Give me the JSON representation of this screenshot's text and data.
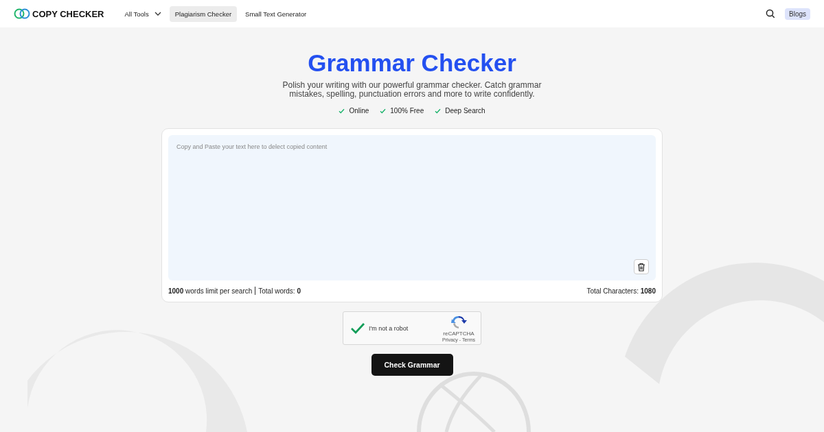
{
  "header": {
    "logo": "COPY CHECKER",
    "nav": [
      {
        "label": "All Tools",
        "dropdown": true,
        "selected": false
      },
      {
        "label": "Plagiarism Checker",
        "dropdown": false,
        "selected": true
      },
      {
        "label": "Small Text Generator",
        "dropdown": false,
        "selected": false
      }
    ],
    "blogs": "Blogs"
  },
  "hero": {
    "title": "Grammar Checker",
    "subtitle": "Polish your writing with our powerful grammar checker. Catch grammar mistakes, spelling, punctuation errors and more to write confidently.",
    "features": [
      "Online",
      "100% Free",
      "Deep Search"
    ]
  },
  "editor": {
    "placeholder": "Copy and Paste your text here to delect copied content",
    "limit": "**1000** words limit per search",
    "total_words": "Total words: **0**",
    "total_characters": "Total Characters: **1080**"
  },
  "captcha": {
    "label": "I'm not a robot",
    "checked": true,
    "brand": "reCAPTCHA",
    "links": "Privacy - Terms"
  },
  "submit": "Check Grammar"
}
